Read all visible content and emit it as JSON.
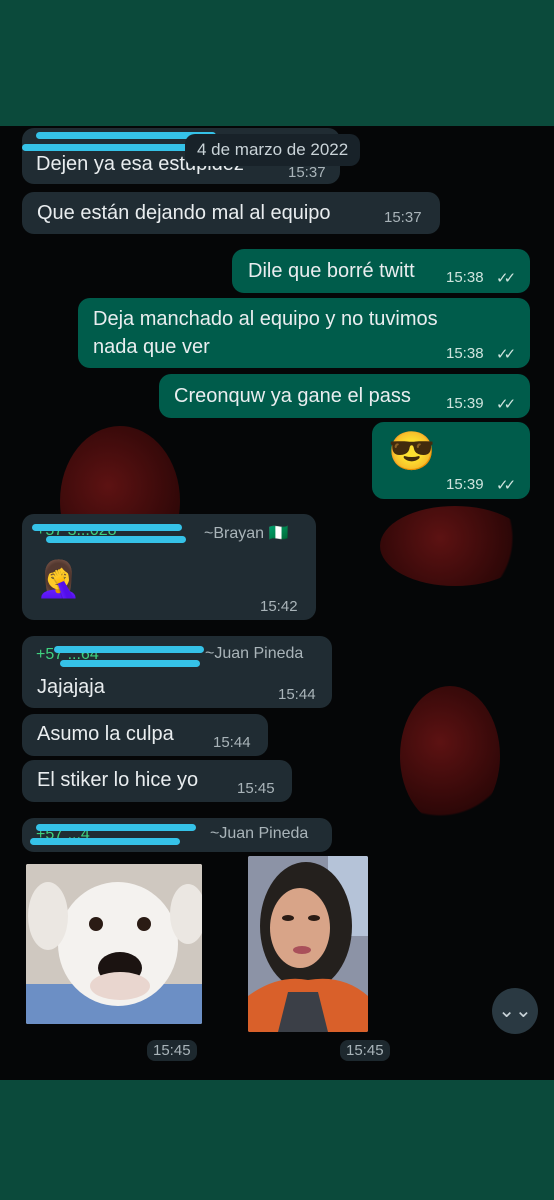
{
  "date_label": "4 de marzo de 2022",
  "messages": [
    {
      "text": "Dejen ya esa estupidez",
      "time": "15:37"
    },
    {
      "text": "Que están dejando mal al equipo",
      "time": "15:37"
    },
    {
      "text": "Dile que borré twitt",
      "time": "15:38"
    },
    {
      "text_line1": "Deja manchado al equipo y no tuvimos",
      "text_line2": "nada que ver",
      "time": "15:38"
    },
    {
      "text": "Creonquw ya gane el pass",
      "time": "15:39"
    },
    {
      "emoji": "😎",
      "time": "15:39"
    },
    {
      "sender_phone": "+57 3...028",
      "sender_name": "~Brayan 🇳🇬",
      "emoji": "🤦‍♀️",
      "time": "15:42"
    },
    {
      "sender_phone": "+57 ...64",
      "sender_name": "~Juan Pineda",
      "text": "Jajajaja",
      "time": "15:44"
    },
    {
      "text": "Asumo la culpa",
      "time": "15:44"
    },
    {
      "text": "El stiker lo hice yo",
      "time": "15:45"
    },
    {
      "sender_phone": "+57 ...4",
      "sender_name": "~Juan Pineda",
      "time_left": "15:45",
      "time_right": "15:45"
    }
  ],
  "ticks": "✓✓",
  "scroll_icon": "⌄⌄",
  "colors": {
    "incoming": "#202c33",
    "outgoing": "#005c4b",
    "sender_phone": "#3fd17f",
    "band": "#0b4a3b"
  }
}
